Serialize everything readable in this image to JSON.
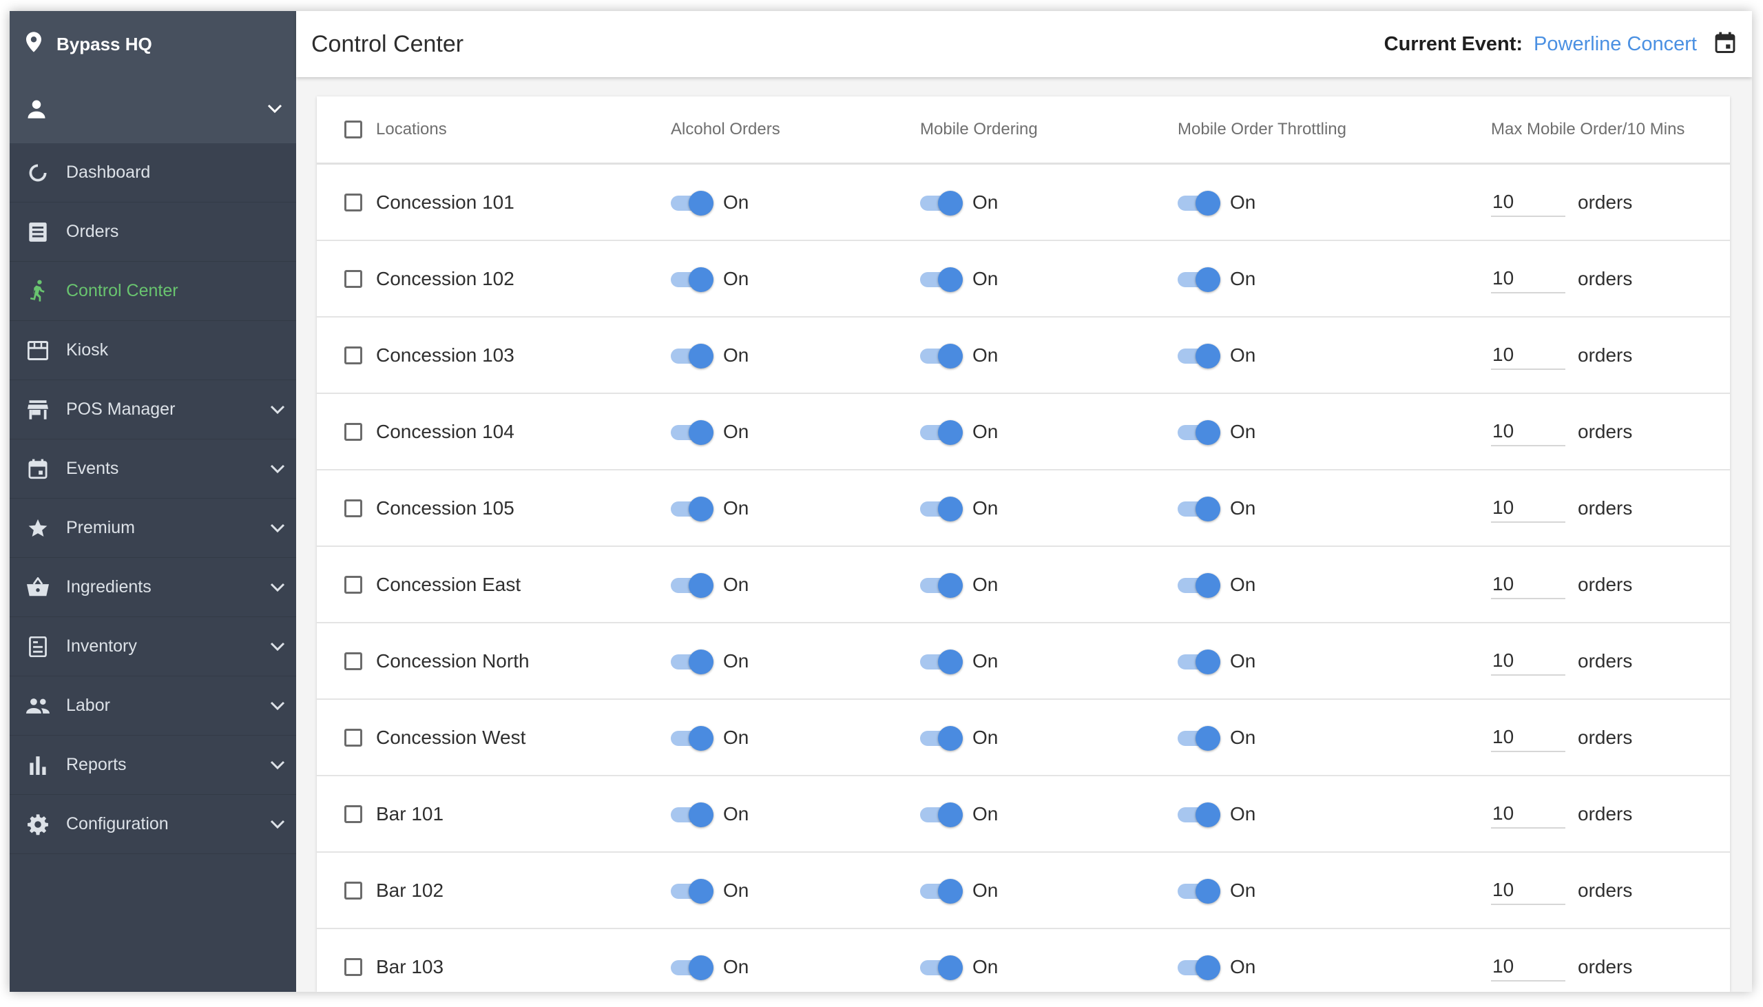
{
  "sidebar": {
    "venue": "Bypass HQ",
    "items": [
      {
        "label": "Dashboard",
        "icon": "refresh-circle-icon",
        "active": false,
        "expandable": false
      },
      {
        "label": "Orders",
        "icon": "list-icon",
        "active": false,
        "expandable": false
      },
      {
        "label": "Control Center",
        "icon": "running-person-icon",
        "active": true,
        "expandable": false
      },
      {
        "label": "Kiosk",
        "icon": "storefront-icon",
        "active": false,
        "expandable": false
      },
      {
        "label": "POS Manager",
        "icon": "store-icon",
        "active": false,
        "expandable": true
      },
      {
        "label": "Events",
        "icon": "calendar-icon",
        "active": false,
        "expandable": true
      },
      {
        "label": "Premium",
        "icon": "star-icon",
        "active": false,
        "expandable": true
      },
      {
        "label": "Ingredients",
        "icon": "basket-icon",
        "active": false,
        "expandable": true
      },
      {
        "label": "Inventory",
        "icon": "clipboard-icon",
        "active": false,
        "expandable": true
      },
      {
        "label": "Labor",
        "icon": "people-icon",
        "active": false,
        "expandable": true
      },
      {
        "label": "Reports",
        "icon": "bar-chart-icon",
        "active": false,
        "expandable": true
      },
      {
        "label": "Configuration",
        "icon": "gear-icon",
        "active": false,
        "expandable": true
      }
    ]
  },
  "header": {
    "title": "Control Center",
    "current_event_label": "Current Event:",
    "current_event_value": "Powerline Concert"
  },
  "table": {
    "columns": [
      "Locations",
      "Alcohol Orders",
      "Mobile Ordering",
      "Mobile Order Throttling",
      "Max Mobile Order/10 Mins"
    ],
    "rows": [
      {
        "location": "Concession 101",
        "alcohol": "On",
        "mobile": "On",
        "throttling": "On",
        "max": "10",
        "unit": "orders"
      },
      {
        "location": "Concession 102",
        "alcohol": "On",
        "mobile": "On",
        "throttling": "On",
        "max": "10",
        "unit": "orders"
      },
      {
        "location": "Concession 103",
        "alcohol": "On",
        "mobile": "On",
        "throttling": "On",
        "max": "10",
        "unit": "orders"
      },
      {
        "location": "Concession 104",
        "alcohol": "On",
        "mobile": "On",
        "throttling": "On",
        "max": "10",
        "unit": "orders"
      },
      {
        "location": "Concession 105",
        "alcohol": "On",
        "mobile": "On",
        "throttling": "On",
        "max": "10",
        "unit": "orders"
      },
      {
        "location": "Concession East",
        "alcohol": "On",
        "mobile": "On",
        "throttling": "On",
        "max": "10",
        "unit": "orders"
      },
      {
        "location": "Concession North",
        "alcohol": "On",
        "mobile": "On",
        "throttling": "On",
        "max": "10",
        "unit": "orders"
      },
      {
        "location": "Concession West",
        "alcohol": "On",
        "mobile": "On",
        "throttling": "On",
        "max": "10",
        "unit": "orders"
      },
      {
        "location": "Bar 101",
        "alcohol": "On",
        "mobile": "On",
        "throttling": "On",
        "max": "10",
        "unit": "orders"
      },
      {
        "location": "Bar 102",
        "alcohol": "On",
        "mobile": "On",
        "throttling": "On",
        "max": "10",
        "unit": "orders"
      },
      {
        "location": "Bar 103",
        "alcohol": "On",
        "mobile": "On",
        "throttling": "On",
        "max": "10",
        "unit": "orders"
      }
    ]
  },
  "colors": {
    "sidebar_bg": "#3a4250",
    "sidebar_header_bg": "#47505e",
    "active_nav": "#69c46f",
    "accent_blue": "#4a90e2",
    "toggle_thumb": "#4a8be0",
    "toggle_track": "#a7c6ef"
  }
}
